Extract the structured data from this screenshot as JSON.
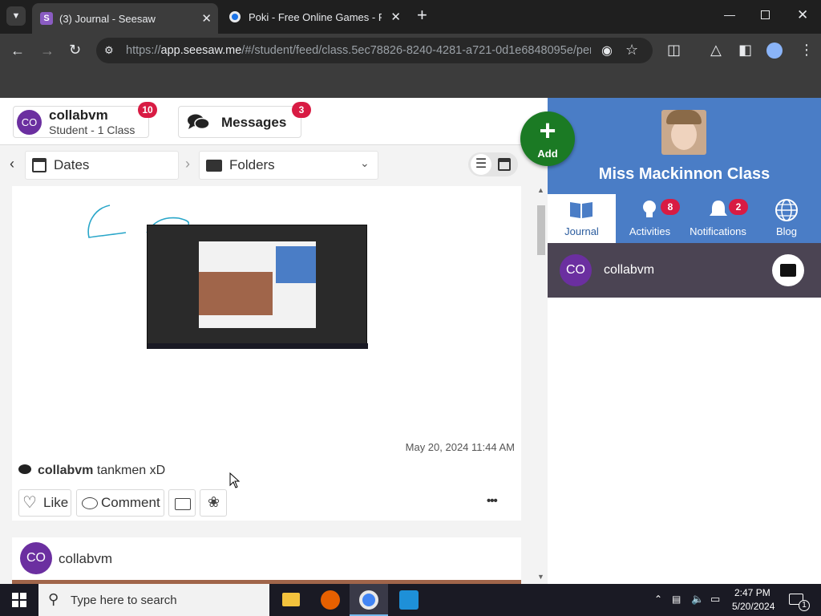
{
  "browser": {
    "tabs": [
      {
        "title": "(3) Journal - Seesaw",
        "active": true
      },
      {
        "title": "Poki - Free Online Games - Pla",
        "active": false
      }
    ],
    "url_prefix": "https://",
    "url_domain": "app.seesaw.me",
    "url_rest": "/#/student/feed/class.5ec78826-8240-4281-a721-0d1e6848095e/pers..."
  },
  "topbar": {
    "avatar_initials": "CO",
    "user_name": "collabvm",
    "user_role": "Student - 1 Class",
    "user_badge": "10",
    "messages_label": "Messages",
    "messages_badge": "3"
  },
  "filters": {
    "dates_label": "Dates",
    "folders_label": "Folders"
  },
  "post": {
    "timestamp": "May 20, 2024 11:44 AM",
    "caption_author": "collabvm",
    "caption_text": "tankmen xD",
    "like_label": "Like",
    "comment_label": "Comment",
    "more_label": "•••"
  },
  "next_post": {
    "avatar_initials": "CO",
    "author": "collabvm"
  },
  "add_button": {
    "label": "Add",
    "icon": "plus-icon"
  },
  "class": {
    "name": "Miss Mackinnon Class"
  },
  "nav": {
    "journal": {
      "label": "Journal"
    },
    "activities": {
      "label": "Activities",
      "badge": "8"
    },
    "notifications": {
      "label": "Notifications",
      "badge": "2"
    },
    "blog": {
      "label": "Blog"
    }
  },
  "student": {
    "avatar_initials": "CO",
    "name": "collabvm"
  },
  "taskbar": {
    "search_placeholder": "Type here to search",
    "time": "2:47 PM",
    "date": "5/20/2024",
    "notification_count": "1"
  },
  "colors": {
    "seesaw_blue": "#4a7dc6",
    "add_green": "#1b7a24",
    "badge_red": "#d81b43",
    "avatar_purple": "#6b2fa0",
    "student_row": "#4b4453"
  }
}
